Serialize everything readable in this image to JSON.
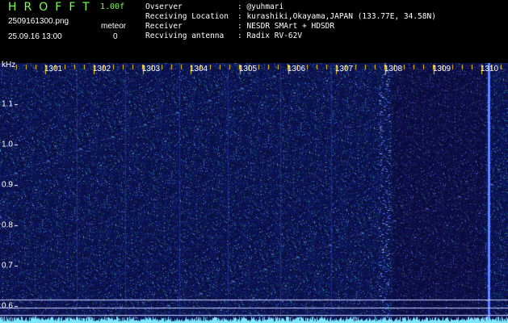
{
  "header": {
    "app_title": "HROFFT",
    "version": "1.00f",
    "filename": "2509161300.png",
    "datetime": "25.09.16 13:00",
    "meteor_label": "meteor",
    "meteor_count": "0",
    "info_rows": [
      {
        "key": "Ovserver",
        "value": ": @yuhmari"
      },
      {
        "key": "Receiving Location",
        "value": ": kurashiki,Okayama,JAPAN (133.77E, 34.58N)"
      },
      {
        "key": "Receiver",
        "value": ": NESDR SMArt + HDSDR"
      },
      {
        "key": "Recviving antenna",
        "value": ": Radix RV-62V"
      }
    ]
  },
  "chart_data": {
    "type": "heatmap",
    "ylabel": "kHz",
    "x_ticks": [
      "1301",
      "1302",
      "1303",
      "1304",
      "1305",
      "1306",
      "1307",
      "1308",
      "1309",
      "1310"
    ],
    "y_ticks": [
      "1.1",
      "1.0",
      "0.9",
      "0.8",
      "0.7",
      "0.6"
    ],
    "ylim": [
      0.58,
      1.15
    ],
    "colors": {
      "background": "#0b0b3c",
      "noise": "#2a3cd0",
      "signal": "#7fe8ff"
    }
  }
}
